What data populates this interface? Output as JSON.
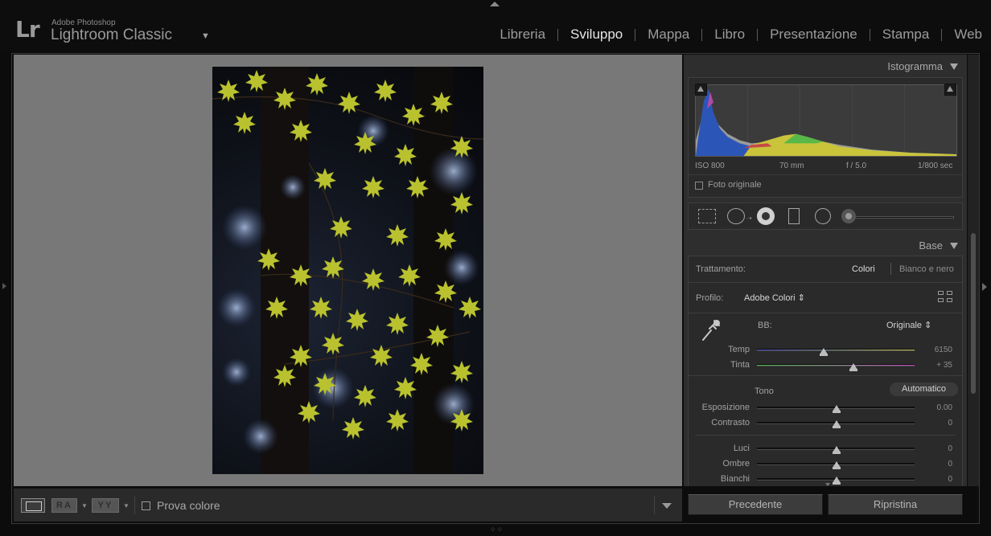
{
  "app": {
    "brand_small": "Adobe Photoshop",
    "brand_name": "Lightroom Classic",
    "logo": "Lr"
  },
  "modules": [
    {
      "label": "Libreria",
      "active": false
    },
    {
      "label": "Sviluppo",
      "active": true
    },
    {
      "label": "Mappa",
      "active": false
    },
    {
      "label": "Libro",
      "active": false
    },
    {
      "label": "Presentazione",
      "active": false
    },
    {
      "label": "Stampa",
      "active": false
    },
    {
      "label": "Web",
      "active": false
    }
  ],
  "toolbar": {
    "ra_label": "RA",
    "yy_label": "YY",
    "proof_label": "Prova colore",
    "proof_checked": false
  },
  "histogram": {
    "title": "Istogramma",
    "iso": "ISO 800",
    "focal": "70 mm",
    "aperture": "f / 5.0",
    "shutter": "1/800 sec",
    "original_label": "Foto originale",
    "original_checked": false
  },
  "base": {
    "title": "Base",
    "treatment_label": "Trattamento:",
    "treatment_color": "Colori",
    "treatment_bw": "Bianco e nero",
    "profile_label": "Profilo:",
    "profile_value": "Adobe Colori",
    "wb_label": "BB:",
    "wb_value": "Originale",
    "temp_label": "Temp",
    "temp_value": "6150",
    "tint_label": "Tinta",
    "tint_value": "+ 35",
    "tone_label": "Tono",
    "auto_label": "Automatico",
    "exposure_label": "Esposizione",
    "exposure_value": "0.00",
    "contrast_label": "Contrasto",
    "contrast_value": "0",
    "highlights_label": "Luci",
    "highlights_value": "0",
    "shadows_label": "Ombre",
    "shadows_value": "0",
    "whites_label": "Bianchi",
    "whites_value": "0"
  },
  "buttons": {
    "previous": "Precedente",
    "reset": "Ripristina"
  },
  "colors": {
    "active_module": "#e6e6e6",
    "inactive_module": "#9c9c9c",
    "panel_bg": "#2e2e2e",
    "canvas_bg": "#787878"
  }
}
